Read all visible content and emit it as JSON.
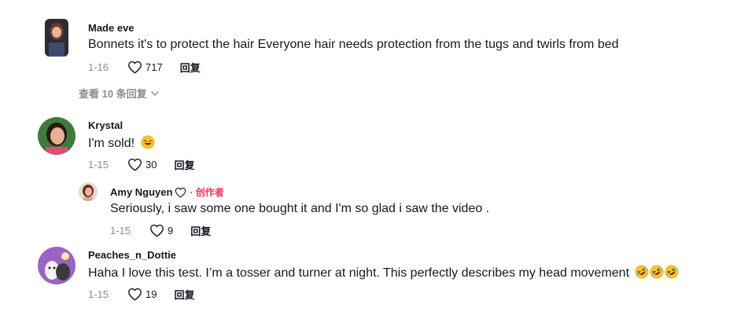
{
  "comments": [
    {
      "username": "Made eve",
      "text": "Bonnets it's to protect the hair Everyone hair needs protection from the tugs and twirls from bed",
      "date": "1-16",
      "likes": "717",
      "reply": "回复"
    },
    {
      "username": "Krystal",
      "text": "I'm sold!",
      "date": "1-15",
      "likes": "30",
      "reply": "回复"
    },
    {
      "username": "Amy Nguyen",
      "badge": "· 创作者",
      "text": "Seriously, i saw some one bought it and I'm so glad i saw the video .",
      "date": "1-15",
      "likes": "9",
      "reply": "回复"
    },
    {
      "username": "Peaches_n_Dottie",
      "text": "Haha I love this test. I’m a tosser and turner at night. This perfectly describes my head movement",
      "date": "1-15",
      "likes": "19",
      "reply": "回复"
    }
  ],
  "view_replies": "查看 10 条回复",
  "colors": {
    "accent": "#fe2c55",
    "text": "#161823",
    "muted": "#8a8b91"
  }
}
